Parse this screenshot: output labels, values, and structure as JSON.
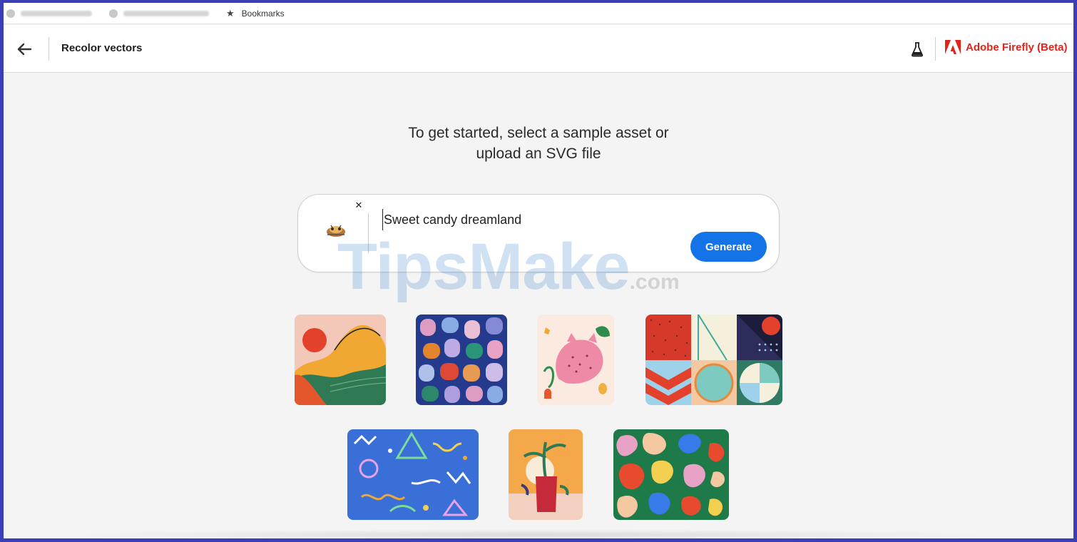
{
  "bookmarks_bar": {
    "items": [
      {
        "icon": "favicon-icon",
        "label": ""
      },
      {
        "icon": "favicon-icon",
        "label": ""
      },
      {
        "icon": "star-icon",
        "label": "Bookmarks"
      }
    ]
  },
  "header": {
    "back_icon": "arrow-left-icon",
    "title": "Recolor vectors",
    "labs_icon": "flask-icon",
    "brand_icon": "adobe-logo-icon",
    "brand_label": "Adobe Firefly (Beta)"
  },
  "main": {
    "intro_line1": "To get started, select a sample asset or",
    "intro_line2": "upload an SVG file",
    "prompt": {
      "value": "Sweet candy dreamland",
      "remove_icon": "close-icon",
      "generate_label": "Generate"
    },
    "samples": [
      {
        "name": "abstract-landscape"
      },
      {
        "name": "animal-pattern"
      },
      {
        "name": "pink-cat-illustration"
      },
      {
        "name": "geometric-grid"
      },
      {
        "name": "squiggle-pattern"
      },
      {
        "name": "plant-vase"
      },
      {
        "name": "blob-pattern"
      }
    ]
  },
  "watermark": {
    "main": "TipsMake",
    "suffix": ".com"
  },
  "colors": {
    "accent": "#1473e6",
    "brand": "#e1251b",
    "frame": "#3a3fb8",
    "background": "#f4f4f4"
  }
}
